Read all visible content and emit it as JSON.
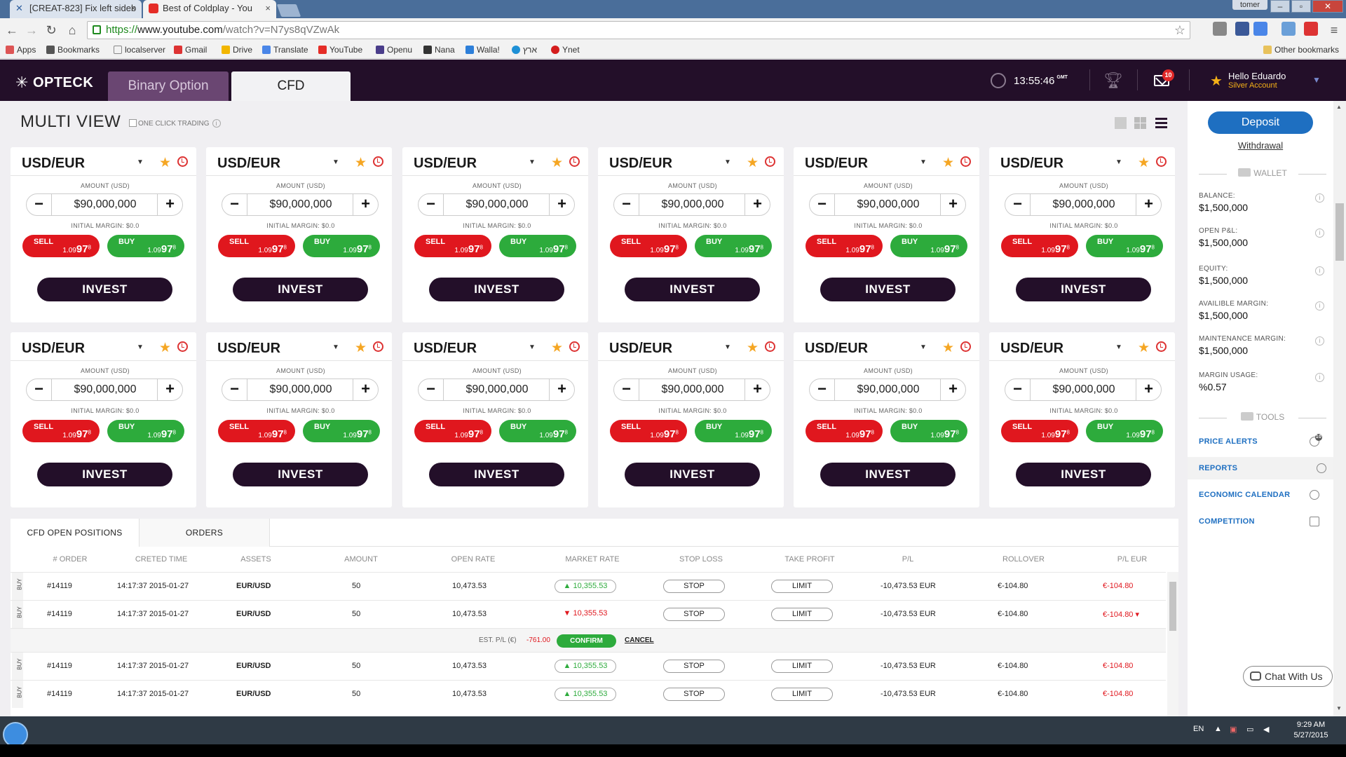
{
  "browser": {
    "tabs": [
      {
        "title": "[CREAT-823] Fix left sideb",
        "close": "×"
      },
      {
        "title": "Best of Coldplay - You",
        "close": "×"
      }
    ],
    "user": "tomer",
    "win_controls": {
      "min": "–",
      "max": "▫",
      "close": "✕"
    },
    "url_https": "https://",
    "url_host": "www.youtube.com",
    "url_rest": "/watch?v=N7ys8qVZwAk",
    "bookmarks": [
      "Apps",
      "Bookmarks",
      "localserver",
      "Gmail",
      "Drive",
      "Translate",
      "YouTube",
      "Openu",
      "Nana",
      "Walla!",
      "ארץ",
      "Ynet"
    ],
    "other_bookmarks": "Other bookmarks"
  },
  "header": {
    "logo": "OPTECK",
    "tab_binary": "Binary Option",
    "tab_cfd": "CFD",
    "time": "13:55:46",
    "tz": "GMT",
    "mail_count": "10",
    "hello": "Hello Eduardo",
    "account": "Silver Account"
  },
  "main": {
    "title": "MULTI VIEW",
    "one_click": "ONE CLICK TRADING",
    "cards": {
      "pair": "USD/EUR",
      "amount_label": "AMOUNT (USD)",
      "amount": "$90,000,000",
      "margin_label": "INITIAL MARGIN: $0.0",
      "sell_label": "SELL",
      "buy_label": "BUY",
      "rate_prefix": "1.09",
      "rate_big": "97",
      "rate_sup": "8",
      "invest_label": "INVEST",
      "count": 12
    }
  },
  "positions": {
    "tabs": [
      "CFD OPEN POSITIONS",
      "ORDERS"
    ],
    "headers": [
      "# ORDER",
      "CRETED TIME",
      "ASSETS",
      "AMOUNT",
      "OPEN RATE",
      "MARKET RATE",
      "STOP LOSS",
      "TAKE PROFIT",
      "P/L",
      "ROLLOVER",
      "P/L EUR"
    ],
    "rows": [
      {
        "side": "BUY",
        "order": "#14119",
        "time": "14:17:37  2015-01-27",
        "asset": "EUR/USD",
        "amount": "50",
        "open_rate": "10,473.53",
        "market_rate": "▲ 10,355.53",
        "dir": "up",
        "stop": "STOP",
        "limit": "LIMIT",
        "pl": "-10,473.53 EUR",
        "rollover": "€-104.80",
        "pl_eur": "€-104.80"
      },
      {
        "side": "BUY",
        "order": "#14119",
        "time": "14:17:37  2015-01-27",
        "asset": "EUR/USD",
        "amount": "50",
        "open_rate": "10,473.53",
        "market_rate": "▼ 10,355.53",
        "dir": "down",
        "stop": "STOP",
        "limit": "LIMIT",
        "pl": "-10,473.53 EUR",
        "rollover": "€-104.80",
        "pl_eur": "€-104.80 ▾"
      },
      {
        "side": "BUY",
        "order": "#14119",
        "time": "14:17:37  2015-01-27",
        "asset": "EUR/USD",
        "amount": "50",
        "open_rate": "10,473.53",
        "market_rate": "▲ 10,355.53",
        "dir": "up",
        "stop": "STOP",
        "limit": "LIMIT",
        "pl": "-10,473.53 EUR",
        "rollover": "€-104.80",
        "pl_eur": "€-104.80"
      },
      {
        "side": "BUY",
        "order": "#14119",
        "time": "14:17:37  2015-01-27",
        "asset": "EUR/USD",
        "amount": "50",
        "open_rate": "10,473.53",
        "market_rate": "▲ 10,355.53",
        "dir": "up",
        "stop": "STOP",
        "limit": "LIMIT",
        "pl": "-10,473.53 EUR",
        "rollover": "€-104.80",
        "pl_eur": "€-104.80"
      }
    ],
    "est_label": "EST. P/L (€)",
    "est_value": "-761.00",
    "confirm": "CONFIRM",
    "cancel": "CANCEL"
  },
  "sidebar": {
    "deposit": "Deposit",
    "withdrawal": "Withdrawal",
    "wallet": "WALLET",
    "stats": [
      {
        "label": "BALANCE:",
        "value": "$1,500,000"
      },
      {
        "label": "OPEN P&L:",
        "value": "$1,500,000"
      },
      {
        "label": "EQUITY:",
        "value": "$1,500,000"
      },
      {
        "label": "AVAILIBLE MARGIN:",
        "value": "$1,500,000"
      },
      {
        "label": "MAINTENANCE MARGIN:",
        "value": "$1,500,000"
      },
      {
        "label": "MARGIN USAGE:",
        "value": "%0.57"
      }
    ],
    "tools": "TOOLS",
    "tool_items": [
      "PRICE ALERTS",
      "REPORTS",
      "ECONOMIC CALENDAR",
      "COMPETITION"
    ],
    "alert_badge": "10",
    "chat": "Chat With Us"
  },
  "taskbar": {
    "lang": "EN",
    "time": "9:29 AM",
    "date": "5/27/2015"
  },
  "colors": {
    "brand_dark": "#230f29",
    "sell": "#e0171e",
    "buy": "#2dab3c",
    "accent": "#1e6fc1"
  }
}
